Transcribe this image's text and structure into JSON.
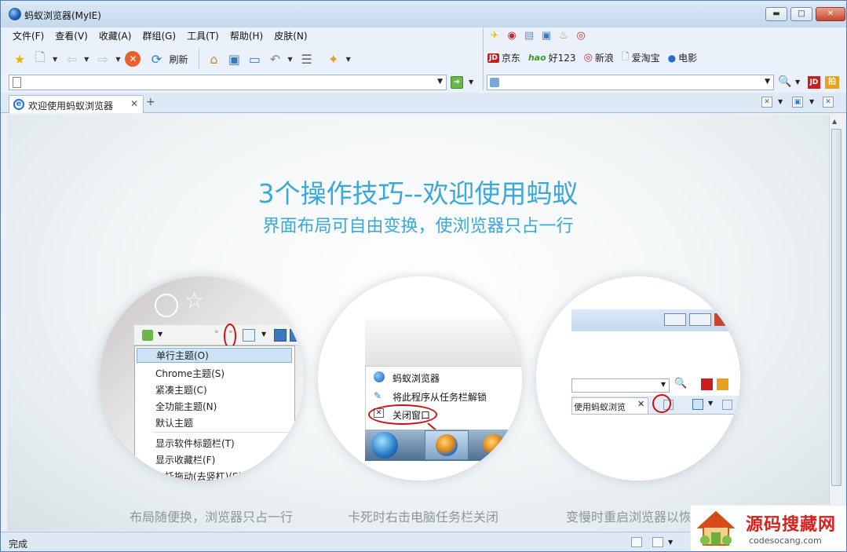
{
  "window": {
    "title": "蚂蚁浏览器(MyIE)",
    "minimize": "▬",
    "maximize": "□",
    "close": "✕"
  },
  "menu": [
    "文件(F)",
    "查看(V)",
    "收藏(A)",
    "群组(G)",
    "工具(T)",
    "帮助(H)",
    "皮肤(N)"
  ],
  "toolbar": {
    "refresh_label": "刷新"
  },
  "quick_links": [
    {
      "label": "京东",
      "icon": "jd-icon"
    },
    {
      "label": "好123",
      "icon": "hao-icon"
    },
    {
      "label": "新浪",
      "icon": "weibo-icon"
    },
    {
      "label": "爱淘宝",
      "icon": "page-icon"
    },
    {
      "label": "电影",
      "icon": "globe-icon"
    }
  ],
  "quick_link_badges": {
    "jd": "JD",
    "hao": "hao"
  },
  "search_buttons": {
    "jd": "JD",
    "pai": "拍"
  },
  "address": {
    "value": ""
  },
  "search": {
    "value": ""
  },
  "tabs": [
    {
      "label": "欢迎使用蚂蚁浏览器"
    }
  ],
  "content": {
    "headline": "3个操作技巧--欢迎使用蚂蚁",
    "subheadline": "界面布局可自由变换，使浏览器只占一行",
    "tips": [
      {
        "caption": "布局随便换，浏览器只占一行",
        "menu_items": [
          "单行主题(O)",
          "Chrome主题(S)",
          "紧凑主题(C)",
          "全功能主题(N)",
          "默认主题",
          "显示软件标题栏(T)",
          "显示收藏栏(F)",
          "…托拖动(去竖杠)(S)"
        ]
      },
      {
        "caption": "卡死时右击电脑任务栏关闭",
        "menu_items": [
          "蚂蚁浏览器",
          "将此程序从任务栏解锁",
          "关闭窗口"
        ]
      },
      {
        "caption": "变慢时重启浏览器以恢",
        "tab_label": "使用蚂蚁浏览"
      }
    ]
  },
  "status": {
    "text": "完成"
  },
  "watermark": {
    "title": "源码搜藏网",
    "url": "codesocang.com"
  },
  "colors": {
    "accent": "#3aa8d8",
    "highlight": "#d01010"
  }
}
